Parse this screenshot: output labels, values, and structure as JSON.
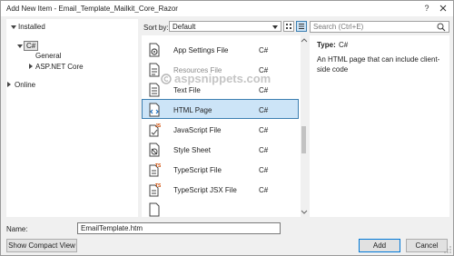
{
  "window": {
    "title": "Add New Item - Email_Template_Mailkit_Core_Razor"
  },
  "tree": {
    "installed": "Installed",
    "csharp": "C#",
    "general": "General",
    "aspnet": "ASP.NET Core",
    "online": "Online"
  },
  "sort": {
    "label": "Sort by:",
    "value": "Default"
  },
  "templates": [
    {
      "name": "App Settings File",
      "lang": "C#",
      "icon": "app-settings-icon"
    },
    {
      "name": "Resources File",
      "lang": "C#",
      "icon": "resources-file-icon"
    },
    {
      "name": "Text File",
      "lang": "C#",
      "icon": "text-file-icon"
    },
    {
      "name": "HTML Page",
      "lang": "C#",
      "icon": "html-page-icon"
    },
    {
      "name": "JavaScript File",
      "lang": "C#",
      "icon": "javascript-file-icon"
    },
    {
      "name": "Style Sheet",
      "lang": "C#",
      "icon": "style-sheet-icon"
    },
    {
      "name": "TypeScript File",
      "lang": "C#",
      "icon": "typescript-file-icon"
    },
    {
      "name": "TypeScript JSX File",
      "lang": "C#",
      "icon": "typescript-jsx-file-icon"
    }
  ],
  "selected_index": 3,
  "search": {
    "placeholder": "Search (Ctrl+E)"
  },
  "details": {
    "type_label": "Type:",
    "type_value": "C#",
    "description": "An HTML page that can include client-side code"
  },
  "watermark": "aspsnippets.com",
  "name_field": {
    "label": "Name:",
    "value": "EmailTemplate.htm"
  },
  "buttons": {
    "compact": "Show Compact View",
    "add": "Add",
    "cancel": "Cancel"
  },
  "colors": {
    "selection_bg": "#cce4f7",
    "selection_border": "#3c7fb1",
    "accent": "#0078d7"
  }
}
